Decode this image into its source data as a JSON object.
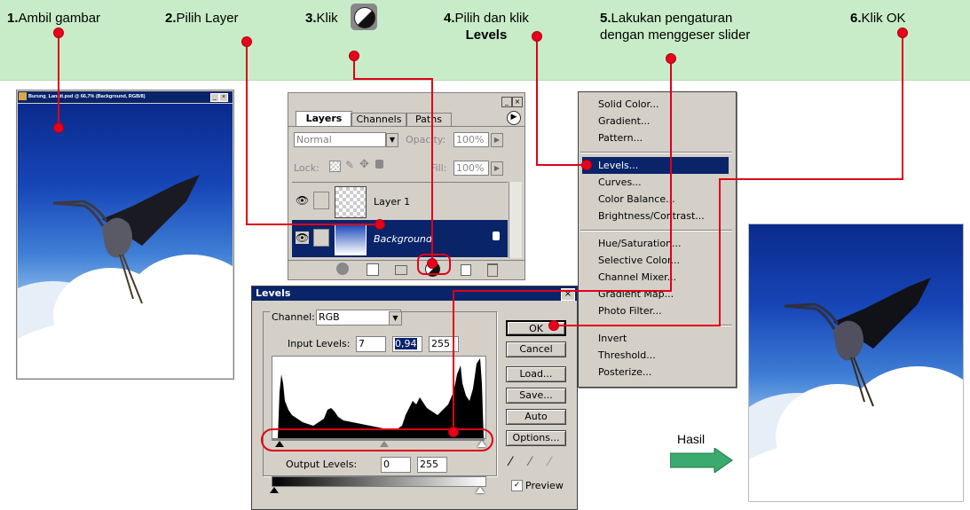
{
  "steps": [
    {
      "num": "1.",
      "text": "Ambil gambar"
    },
    {
      "num": "2.",
      "text": "Pilih Layer"
    },
    {
      "num": "3.",
      "text": "Klik"
    },
    {
      "num": "4.",
      "text": "Pilih dan klik",
      "bold": "Levels"
    },
    {
      "num": "5.",
      "text": "Lakukan pengaturan",
      "text2": "dengan menggeser slider"
    },
    {
      "num": "6.",
      "text": "Klik OK"
    }
  ],
  "doc_window": {
    "title": "Burung_Langit.psd @ 66,7% (Background, RGB/8)"
  },
  "layers_panel": {
    "tabs": [
      "Layers",
      "Channels",
      "Paths"
    ],
    "blend_mode": "Normal",
    "opacity_label": "Opacity:",
    "opacity_value": "100%",
    "lock_label": "Lock:",
    "fill_label": "Fill:",
    "fill_value": "100%",
    "layers": [
      {
        "name": "Layer 1",
        "selected": false
      },
      {
        "name": "Background",
        "selected": true
      }
    ]
  },
  "adjust_menu": {
    "groups": [
      [
        "Solid Color...",
        "Gradient...",
        "Pattern..."
      ],
      [
        "Levels...",
        "Curves...",
        "Color Balance...",
        "Brightness/Contrast..."
      ],
      [
        "Hue/Saturation...",
        "Selective Color...",
        "Channel Mixer...",
        "Gradient Map...",
        "Photo Filter..."
      ],
      [
        "Invert",
        "Threshold...",
        "Posterize..."
      ]
    ],
    "highlighted": "Levels..."
  },
  "levels_dialog": {
    "title": "Levels",
    "channel_label": "Channel:",
    "channel_value": "RGB",
    "input_label": "Input Levels:",
    "input_black": "7",
    "input_gamma": "0,94",
    "input_white": "255",
    "output_label": "Output Levels:",
    "output_black": "0",
    "output_white": "255",
    "buttons": [
      "OK",
      "Cancel",
      "Load...",
      "Save...",
      "Auto",
      "Options..."
    ],
    "preview_label": "Preview",
    "preview_checked": true
  },
  "result_label": "Hasil",
  "colors": {
    "banner": "#c8ecc8",
    "accent_red": "#e00018",
    "titlebar": "#0a246a",
    "arrow": "#3aaa6e"
  }
}
